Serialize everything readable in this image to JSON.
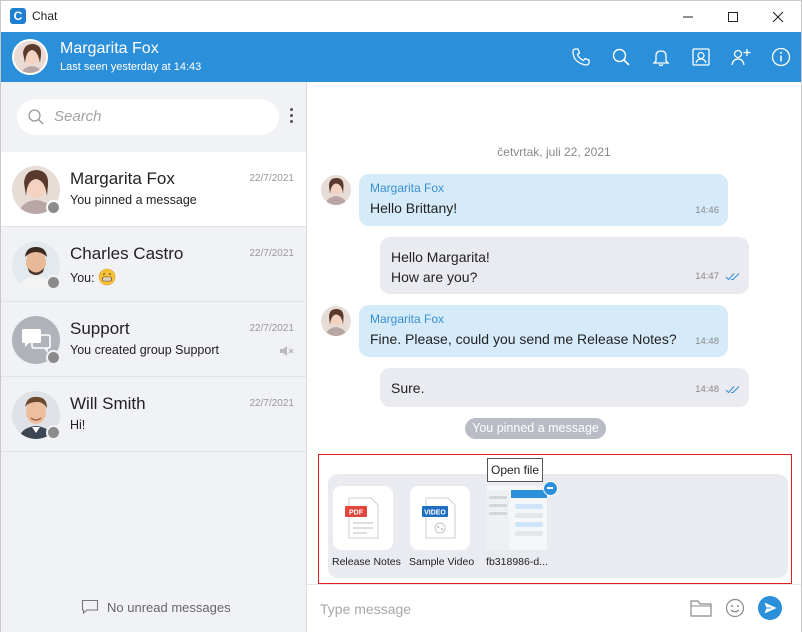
{
  "window": {
    "title": "Chat"
  },
  "header": {
    "contact_name": "Margarita Fox",
    "last_seen": "Last seen yesterday at 14:43"
  },
  "sidebar": {
    "search_placeholder": "Search",
    "conversations": [
      {
        "name": "Margarita Fox",
        "date": "22/7/2021",
        "preview": "You pinned a message"
      },
      {
        "name": "Charles Castro",
        "date": "22/7/2021",
        "preview": "You: "
      },
      {
        "name": "Support",
        "date": "22/7/2021",
        "preview": "You created group Support"
      },
      {
        "name": "Will Smith",
        "date": "22/7/2021",
        "preview": "Hi!"
      }
    ],
    "no_unread": "No unread messages"
  },
  "chat": {
    "date_separator": "četvrtak, juli 22, 2021",
    "messages": [
      {
        "sender": "Margarita Fox",
        "text": "Hello Brittany!",
        "time": "14:46"
      },
      {
        "line1": "Hello Margarita!",
        "line2": "How are you?",
        "time": "14:47"
      },
      {
        "sender": "Margarita Fox",
        "text": "Fine. Please, could you send me Release Notes?",
        "time": "14:48"
      },
      {
        "text": "Sure.",
        "time": "14:48"
      }
    ],
    "pinned_notice": "You pinned a message"
  },
  "attachments": {
    "tooltip": "Open file",
    "files": [
      {
        "name": "Release Notes",
        "badge": "PDF"
      },
      {
        "name": "Sample Video",
        "badge": "VIDEO"
      },
      {
        "name": "fb318986-d..."
      }
    ]
  },
  "composer": {
    "placeholder": "Type message"
  },
  "colors": {
    "accent": "#2b8fd9",
    "incoming_bubble": "#d6ebfa",
    "outgoing_bubble": "#e9ebf0",
    "sidebar_bg": "#f1f2f6"
  },
  "icons": [
    "app-icon",
    "minimize-icon",
    "maximize-icon",
    "close-icon",
    "phone-icon",
    "search-icon",
    "bell-icon",
    "contact-card-icon",
    "add-user-icon",
    "info-icon",
    "more-icon",
    "mute-icon",
    "chat-bubble-icon",
    "folder-icon",
    "emoji-icon",
    "send-icon"
  ]
}
